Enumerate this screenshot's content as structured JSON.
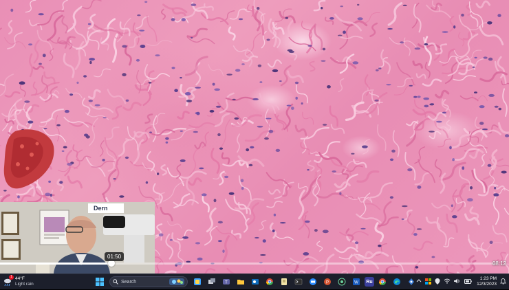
{
  "video": {
    "current_time": "01:50",
    "duration": "08:12",
    "progress_fraction": 0.224
  },
  "pip": {
    "poster_text": "Dern"
  },
  "taskbar": {
    "weather": {
      "temperature": "44°F",
      "condition": "Light rain",
      "badge_count": "1"
    },
    "search_placeholder": "Search",
    "pinned_apps": [
      "start-icon",
      "search",
      "widgets-icon",
      "task-view-icon",
      "teams-icon",
      "file-explorer-icon",
      "outlook-icon",
      "chrome-icon",
      "notes-icon",
      "terminal-icon",
      "zoom-icon",
      "powerpoint-icon",
      "app-icon",
      "word-icon",
      "ru-icon",
      "chrome-alt-icon",
      "edge-icon",
      "app2-icon"
    ],
    "ru_label": "Ru",
    "clock": {
      "time": "1:23 PM",
      "date": "12/3/2023"
    }
  },
  "colors": {
    "stroma": "#e98fb6",
    "nuclei": "#5b3f8e",
    "taskbar": "#1c1f2b",
    "accent_blue": "#2b88d8"
  }
}
